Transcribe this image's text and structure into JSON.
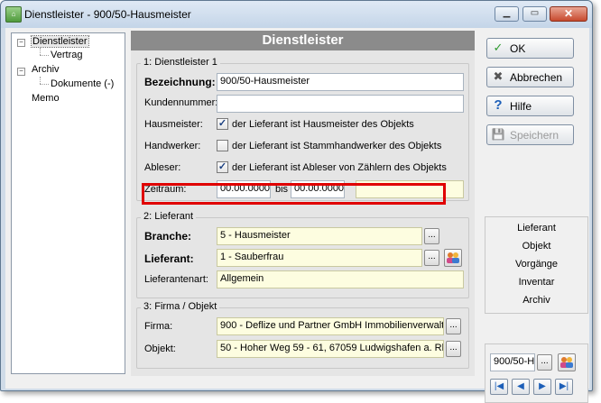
{
  "window": {
    "title": "Dienstleister - 900/50-Hausmeister"
  },
  "tree": {
    "items": [
      "Dienstleister",
      "Vertrag",
      "Archiv",
      "Dokumente (-)",
      "Memo"
    ]
  },
  "panel": {
    "title": "Dienstleister",
    "group1": {
      "label": "1: Dienstleister 1",
      "bezeichnung_label": "Bezeichnung:",
      "bezeichnung_value": "900/50-Hausmeister",
      "kundennummer_label": "Kundennummer:",
      "kundennummer_value": "",
      "hausmeister_label": "Hausmeister:",
      "hausmeister_text": "der Lieferant ist Hausmeister des Objekts",
      "hausmeister_checked": true,
      "handwerker_label": "Handwerker:",
      "handwerker_text": "der Lieferant ist Stammhandwerker des Objekts",
      "handwerker_checked": false,
      "ableser_label": "Ableser:",
      "ableser_text": "der Lieferant ist Ableser von Zählern des Objekts",
      "ableser_checked": true,
      "zeitraum_label": "Zeitraum:",
      "zeitraum_from": "00.00.0000",
      "zeitraum_bis": "bis",
      "zeitraum_to": "00.00.0000"
    },
    "group2": {
      "label": "2: Lieferant",
      "branche_label": "Branche:",
      "branche_value": "5 - Hausmeister",
      "lieferant_label": "Lieferant:",
      "lieferant_value": "1 - Sauberfrau",
      "lieferantenart_label": "Lieferantenart:",
      "lieferantenart_value": "Allgemein"
    },
    "group3": {
      "label": "3: Firma / Objekt",
      "firma_label": "Firma:",
      "firma_value": "900 - Deflize und Partner GmbH Immobilienverwaltur",
      "objekt_label": "Objekt:",
      "objekt_value": "50 - Hoher Weg 59 - 61, 67059 Ludwigshafen a. Rh"
    }
  },
  "buttons": {
    "ok": "OK",
    "abbrechen": "Abbrechen",
    "hilfe": "Hilfe",
    "speichern": "Speichern"
  },
  "nav_list": [
    "Lieferant",
    "Objekt",
    "Vorgänge",
    "Inventar",
    "Archiv"
  ],
  "navigator": {
    "record": "900/50-H",
    "dots": "..."
  },
  "dots_label": "...",
  "icons": {
    "check": "✓",
    "cross": "✖",
    "help": "?",
    "save": "💾",
    "first": "|◀",
    "prev": "◀",
    "next": "▶",
    "last": "▶|"
  },
  "colors": {
    "highlight": "#e00000",
    "panel_title_bg": "#8b8b8b",
    "yellow_field": "#fdfde0"
  }
}
